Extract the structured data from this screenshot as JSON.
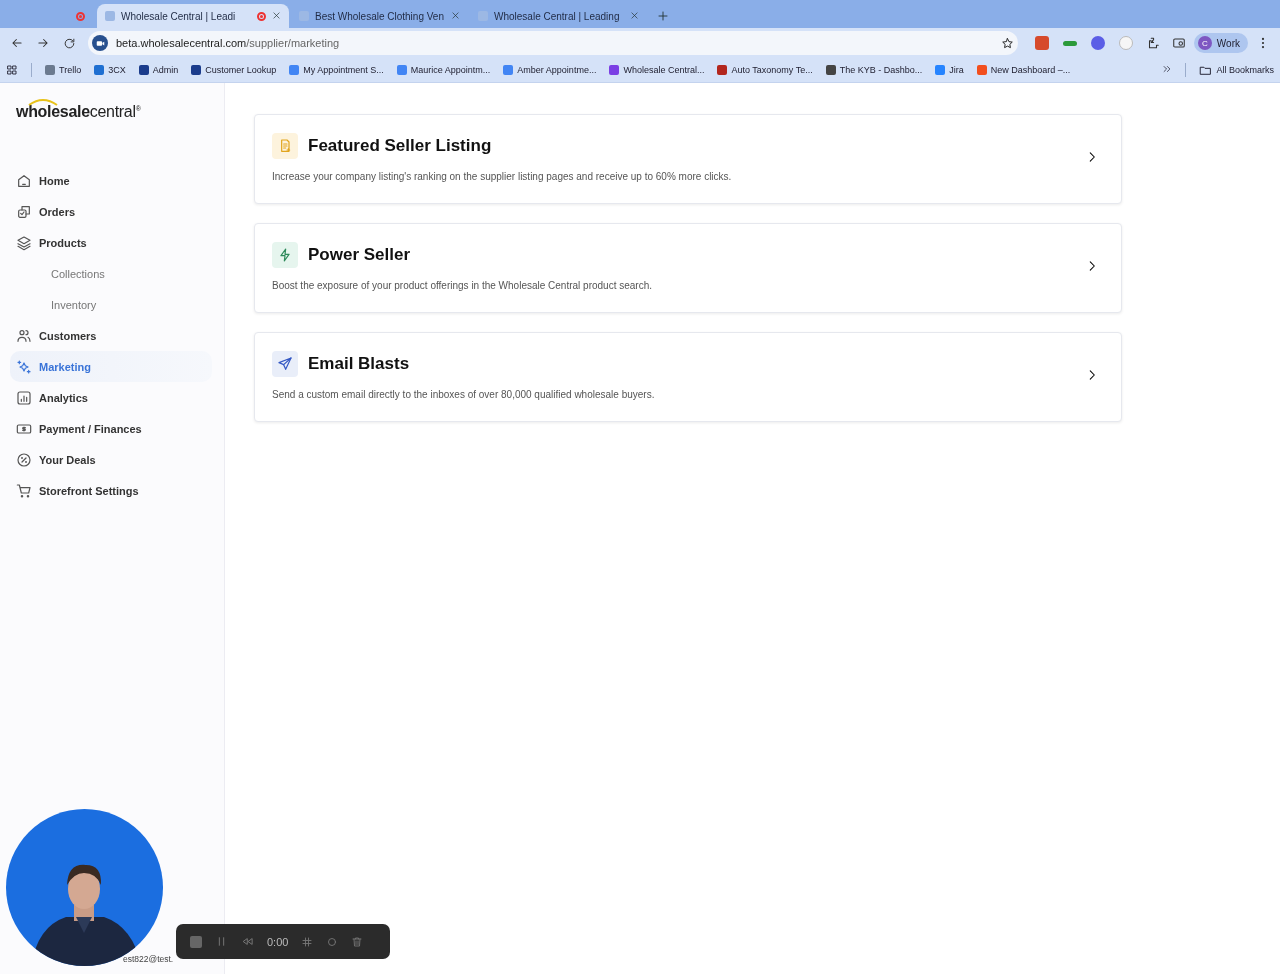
{
  "browser": {
    "tabs": [
      {
        "selected": false,
        "recording": true
      },
      {
        "title": "Wholesale Central | Leadi",
        "selected": true,
        "recording": true
      },
      {
        "title": "Best Wholesale Clothing Ven",
        "selected": false,
        "recording": false
      },
      {
        "title": "Wholesale Central | Leading",
        "selected": false,
        "recording": false
      }
    ],
    "address": {
      "host": "beta.wholesalecentral.com",
      "path": "/supplier/marketing"
    },
    "profile": {
      "initial": "C",
      "label": "Work"
    },
    "bookmarks": [
      {
        "label": "Trello",
        "color": "#6b7a8f"
      },
      {
        "label": "3CX",
        "color": "#1f6fd1"
      },
      {
        "label": "Admin",
        "color": "#1b3c8c"
      },
      {
        "label": "Customer Lookup",
        "color": "#1b3c8c"
      },
      {
        "label": "My Appointment S...",
        "color": "#4285f4"
      },
      {
        "label": "Maurice Appointm...",
        "color": "#4285f4"
      },
      {
        "label": "Amber Appointme...",
        "color": "#4285f4"
      },
      {
        "label": "Wholesale Central...",
        "color": "#7b3fe4"
      },
      {
        "label": "Auto Taxonomy Te...",
        "color": "#b3261e"
      },
      {
        "label": "The KYB - Dashbo...",
        "color": "#444444"
      },
      {
        "label": "Jira",
        "color": "#2684ff"
      },
      {
        "label": "New Dashboard –...",
        "color": "#f24e1e"
      }
    ],
    "all_bookmarks": "All Bookmarks"
  },
  "sidebar": {
    "logo": {
      "word1": "wholesale",
      "word2": "central",
      "mark": "®"
    },
    "items": [
      {
        "label": "Home",
        "selected": false
      },
      {
        "label": "Orders",
        "selected": false
      },
      {
        "label": "Products",
        "selected": false,
        "children": [
          {
            "label": "Collections",
            "selected": false
          },
          {
            "label": "Inventory",
            "selected": false
          }
        ]
      },
      {
        "label": "Customers",
        "selected": false
      },
      {
        "label": "Marketing",
        "selected": true
      },
      {
        "label": "Analytics",
        "selected": false
      },
      {
        "label": "Payment / Finances",
        "selected": false
      },
      {
        "label": "Your Deals",
        "selected": false
      },
      {
        "label": "Storefront Settings",
        "selected": false
      }
    ],
    "account_email": "est822@test."
  },
  "cards": [
    {
      "title": "Featured Seller Listing",
      "description": "Increase your company listing's ranking on the supplier listing pages and receive up to 60% more clicks."
    },
    {
      "title": "Power Seller",
      "description": "Boost the exposure of your product offerings in the Wholesale Central product search."
    },
    {
      "title": "Email Blasts",
      "description": "Send a custom email directly to the inboxes of over 80,000 qualified wholesale buyers."
    }
  ],
  "recorder": {
    "time": "0:00"
  }
}
